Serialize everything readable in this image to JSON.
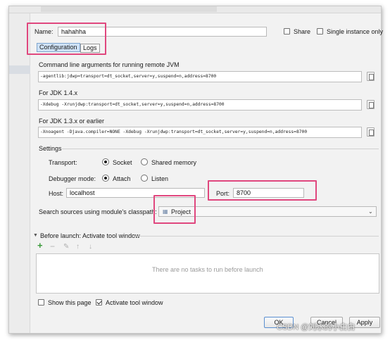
{
  "header": {
    "name_label": "Name:",
    "name_value": "hahahha",
    "share_label": "Share",
    "share_checked": false,
    "single_instance_label": "Single instance only",
    "single_instance_checked": false
  },
  "tabs": [
    {
      "label": "Configuration",
      "active": true
    },
    {
      "label": "Logs",
      "active": false
    }
  ],
  "jvm": {
    "remote_label": "Command line arguments for running remote JVM",
    "remote_value": "-agentlib:jdwp=transport=dt_socket,server=y,suspend=n,address=8700",
    "jdk14_label": "For JDK 1.4.x",
    "jdk14_value": "-Xdebug -Xrunjdwp:transport=dt_socket,server=y,suspend=n,address=8700",
    "jdk13_label": "For JDK 1.3.x or earlier",
    "jdk13_value": "-Xnoagent -Djava.compiler=NONE -Xdebug -Xrunjdwp:transport=dt_socket,server=y,suspend=n,address=8700"
  },
  "settings": {
    "title": "Settings",
    "transport_label": "Transport:",
    "transport_options": [
      "Socket",
      "Shared memory"
    ],
    "transport_selected": "Socket",
    "debugger_mode_label": "Debugger mode:",
    "debugger_mode_options": [
      "Attach",
      "Listen"
    ],
    "debugger_mode_selected": "Attach",
    "host_label": "Host:",
    "host_value": "localhost",
    "port_label": "Port:",
    "port_value": "8700",
    "classpath_label": "Search sources using module's classpath:",
    "classpath_value": "Project"
  },
  "before_launch": {
    "title": "Before launch: Activate tool window",
    "empty_text": "There are no tasks to run before launch",
    "toolbar_icons": [
      "add-icon",
      "remove-icon",
      "edit-icon",
      "move-up-icon",
      "move-down-icon"
    ]
  },
  "footer": {
    "show_page_label": "Show this page",
    "show_page_checked": false,
    "activate_label": "Activate tool window",
    "activate_checked": true,
    "ok_label": "OK",
    "cancel_label": "Cancel",
    "apply_label": "Apply"
  },
  "watermark": "CSDN @刘水的小白白",
  "colors": {
    "highlight_box": "#e0477e",
    "active_tab": "#cfe2f6",
    "add_icon": "#3a9a3a",
    "ok_border": "#5a8fd0"
  }
}
